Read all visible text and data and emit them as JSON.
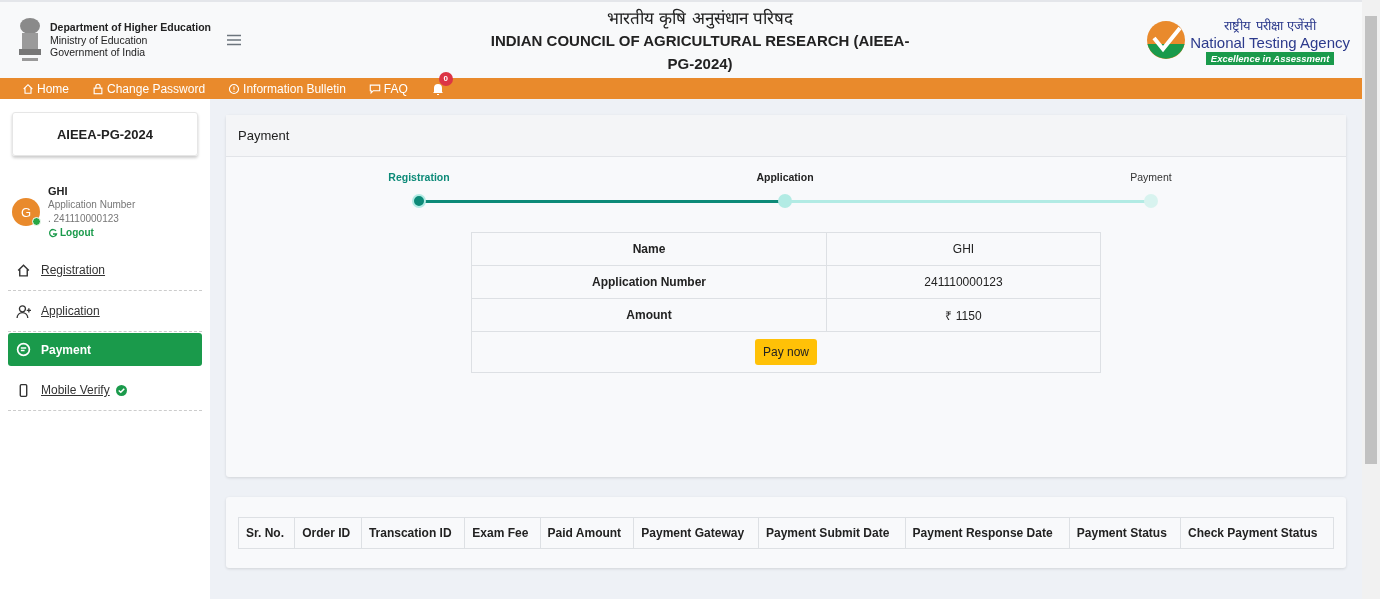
{
  "header": {
    "org_lines": [
      "Department of Higher Education",
      "Ministry of Education",
      "Government of India"
    ],
    "title_hindi": "भारतीय कृषि अनुसंधान परिषद",
    "title": "INDIAN COUNCIL OF AGRICULTURAL RESEARCH (AIEEA-PG-2024)",
    "agency_hindi": "राष्ट्रीय परीक्षा एजेंसी",
    "agency": "National Testing Agency",
    "agency_tagline": "Excellence in Assessment"
  },
  "nav": {
    "items": [
      {
        "label": "Home"
      },
      {
        "label": "Change Password"
      },
      {
        "label": "Information Bulletin"
      },
      {
        "label": "FAQ"
      }
    ],
    "notification_count": "0"
  },
  "sidebar": {
    "exam": "AIEEA-PG-2024",
    "user": {
      "initial": "G",
      "name": "GHI",
      "number_label": "Application Number",
      "number": ". 241110000123",
      "online": true,
      "logout": "Logout"
    },
    "items": [
      {
        "label": "Registration",
        "selected": false,
        "verified": false
      },
      {
        "label": "Application",
        "selected": false,
        "verified": false
      },
      {
        "label": "Payment",
        "selected": true,
        "verified": false
      },
      {
        "label": "Mobile Verify",
        "selected": false,
        "verified": true
      }
    ]
  },
  "payment_card": {
    "title": "Payment",
    "steps": [
      {
        "label": "Registration",
        "completed": true,
        "current": false
      },
      {
        "label": "Application",
        "completed": false,
        "current": true
      },
      {
        "label": "Payment",
        "completed": false,
        "current": false
      }
    ],
    "rows": [
      {
        "label": "Name",
        "value": "GHI"
      },
      {
        "label": "Application Number",
        "value": "241110000123"
      },
      {
        "label": "Amount",
        "value": "₹ 1150"
      }
    ],
    "button": "Pay now"
  },
  "history_table": {
    "columns": [
      "Sr. No.",
      "Order ID",
      "Transcation ID",
      "Exam Fee",
      "Paid Amount",
      "Payment Gateway",
      "Payment Submit Date",
      "Payment Response Date",
      "Payment Status",
      "Check Payment Status"
    ]
  }
}
